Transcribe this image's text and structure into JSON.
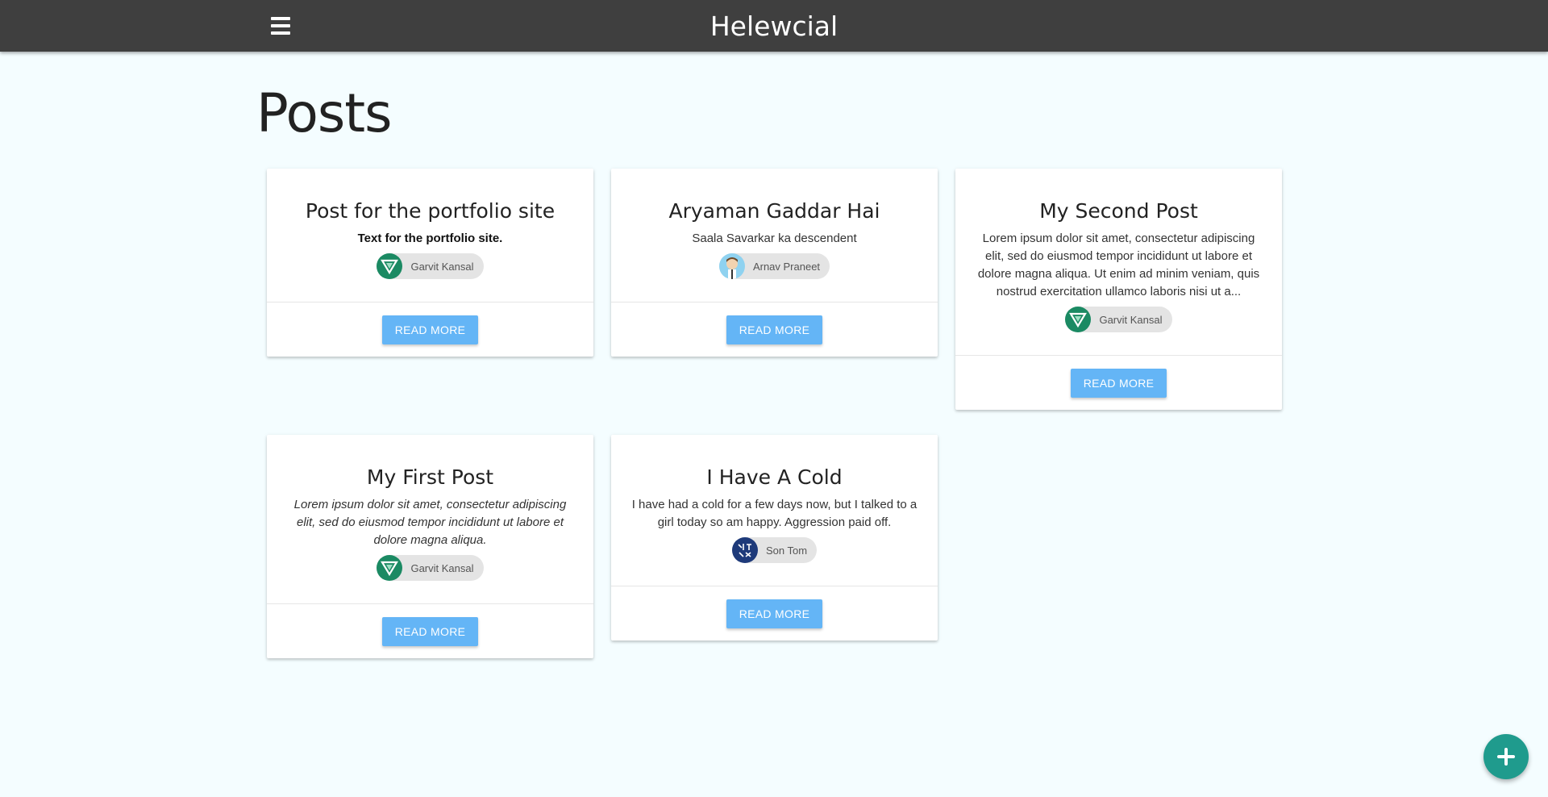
{
  "navbar": {
    "brand": "Helewcial",
    "menu_icon": "hamburger-menu-icon"
  },
  "page": {
    "title": "Posts"
  },
  "colors": {
    "navbar": "#3f3f3f",
    "background": "#f4fdff",
    "button": "#64b5f6",
    "fab": "#1f9b8d"
  },
  "posts": [
    {
      "title": "Post for the portfolio site",
      "text": "Text for the portfolio site.",
      "author": "Garvit Kansal",
      "button": "READ MORE"
    },
    {
      "title": "Aryaman Gaddar Hai",
      "text": "Saala Savarkar ka descendent",
      "author": "Arnav Praneet",
      "button": "READ MORE"
    },
    {
      "title": "My Second Post",
      "text": "Lorem ipsum dolor sit amet, consectetur adipiscing elit, sed do eiusmod tempor incididunt ut labore et dolore magna aliqua. Ut enim ad minim veniam, quis nostrud exercitation ullamco laboris nisi ut a...",
      "author": "Garvit Kansal",
      "button": "READ MORE"
    },
    {
      "title": "My First Post",
      "text": "Lorem ipsum dolor sit amet, consectetur adipiscing elit, sed do eiusmod tempor incididunt ut labore et dolore magna aliqua.",
      "author": "Garvit Kansal",
      "button": "READ MORE"
    },
    {
      "title": "I Have A Cold",
      "text": "I have had a cold for a few days now, but I talked to a girl today so am happy. Aggression paid off.",
      "author": "Son Tom",
      "button": "READ MORE"
    }
  ],
  "fab": {
    "icon": "plus-icon"
  }
}
